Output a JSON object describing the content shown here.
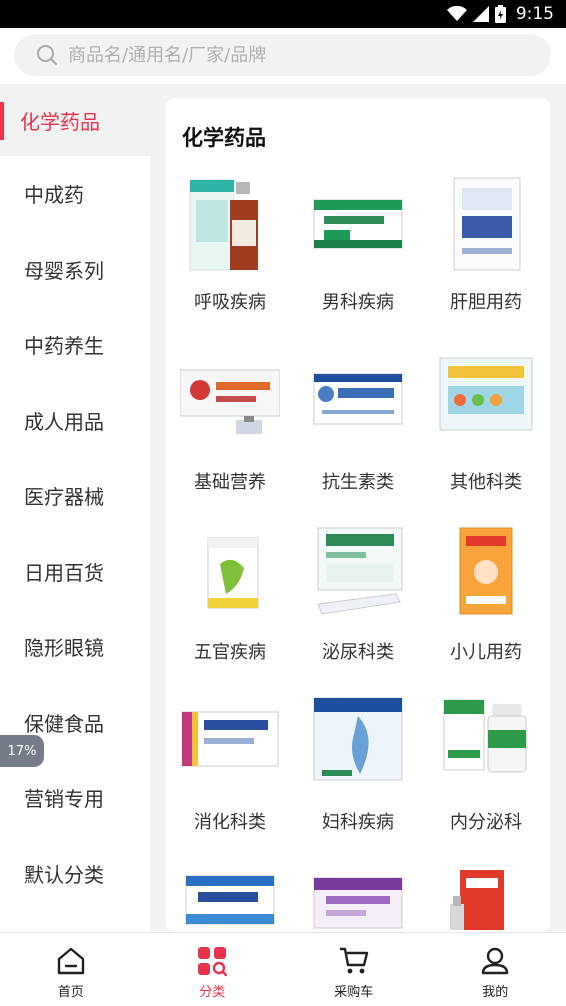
{
  "status": {
    "time": "9:15"
  },
  "search": {
    "placeholder": "商品名/通用名/厂家/品牌"
  },
  "sidebar": {
    "items": [
      {
        "label": "化学药品",
        "active": true
      },
      {
        "label": "中成药"
      },
      {
        "label": "母婴系列"
      },
      {
        "label": "中药养生"
      },
      {
        "label": "成人用品"
      },
      {
        "label": "医疗器械"
      },
      {
        "label": "日用百货"
      },
      {
        "label": "隐形眼镜"
      },
      {
        "label": "保健食品"
      },
      {
        "label": "营销专用"
      },
      {
        "label": "默认分类"
      }
    ],
    "badge": "17%"
  },
  "main": {
    "title": "化学药品",
    "categories": [
      {
        "label": "呼吸疾病",
        "icon": "syrup-bottle-icon"
      },
      {
        "label": "男科疾病",
        "icon": "green-box-icon"
      },
      {
        "label": "肝胆用药",
        "icon": "white-box-icon"
      },
      {
        "label": "基础营养",
        "icon": "vial-box-icon"
      },
      {
        "label": "抗生素类",
        "icon": "capsule-box-icon"
      },
      {
        "label": "其他科类",
        "icon": "kids-box-icon"
      },
      {
        "label": "五官疾病",
        "icon": "ear-drops-icon"
      },
      {
        "label": "泌尿科类",
        "icon": "granule-box-icon"
      },
      {
        "label": "小儿用药",
        "icon": "child-medicine-icon"
      },
      {
        "label": "消化科类",
        "icon": "tablet-box-icon"
      },
      {
        "label": "妇科疾病",
        "icon": "lotion-box-icon"
      },
      {
        "label": "内分泌科",
        "icon": "pill-bottle-icon"
      },
      {
        "label": "",
        "icon": "blue-tablet-box-icon"
      },
      {
        "label": "",
        "icon": "purple-box-icon"
      },
      {
        "label": "",
        "icon": "red-spray-icon"
      }
    ]
  },
  "bottom_nav": [
    {
      "label": "首页",
      "icon": "home-icon"
    },
    {
      "label": "分类",
      "icon": "category-icon",
      "active": true
    },
    {
      "label": "采购车",
      "icon": "cart-icon"
    },
    {
      "label": "我的",
      "icon": "profile-icon"
    }
  ],
  "colors": {
    "accent": "#e8334a"
  }
}
